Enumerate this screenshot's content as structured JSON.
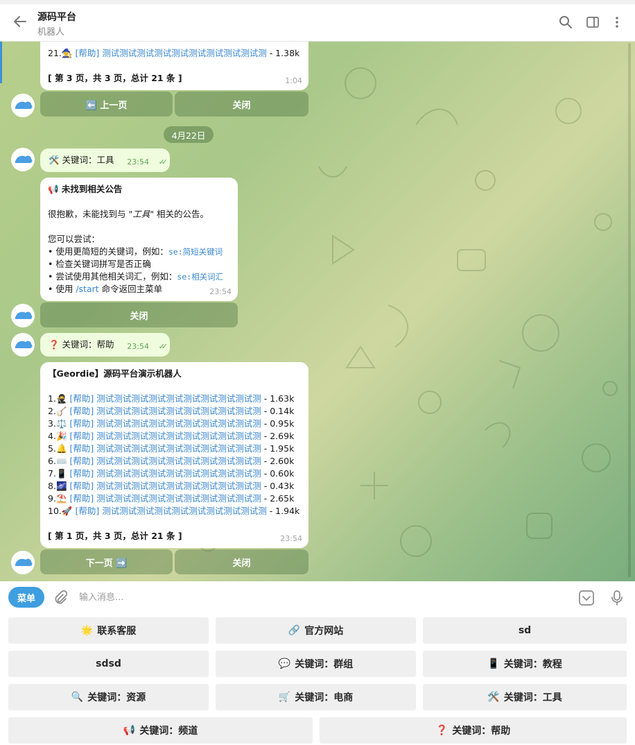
{
  "header": {
    "title": "源码平台",
    "subtitle": "机器人"
  },
  "avatar_text": "源码平台",
  "date_separator": "4月22日",
  "msg_top": {
    "line21_num": "21.",
    "line21_emoji": "🧙",
    "line21_tag": "[帮助]",
    "line21_text": "测试测试测试测试测试测试测试测试测试测",
    "line21_size": "- 1.38k",
    "page_info": "[ 第 3 页，共 3 页，总计 21 条 ]",
    "time": "1:04"
  },
  "kb_top": {
    "prev": "⬅️ 上一页",
    "close": "关闭"
  },
  "msg_kw_tool": {
    "text": "🛠️ 关键词：工具",
    "time": "23:54",
    "ticks": "✓✓"
  },
  "msg_not_found": {
    "title": "📢 未找到相关公告",
    "sorry_pre": "很抱歉，未能找到与 \"",
    "sorry_kw": "工具",
    "sorry_post": "\" 相关的公告。",
    "try": "您可以尝试：",
    "tip1_pre": "• 使用更简短的关键词，例如：",
    "tip1_code": "se:简短关键词",
    "tip2": "• 检查关键词拼写是否正确",
    "tip3_pre": "• 尝试使用其他相关词汇，例如：",
    "tip3_code": "se:相关词汇",
    "tip4_pre": "• 使用 ",
    "tip4_link": "/start",
    "tip4_post": " 命令返回主菜单",
    "time": "23:54"
  },
  "kb_mid": {
    "close": "关闭"
  },
  "msg_kw_help": {
    "text": "❓ 关键词：帮助",
    "time": "23:54",
    "ticks": "✓✓"
  },
  "msg_list": {
    "title": "【Geordie】源码平台演示机器人",
    "items": [
      {
        "num": "1.",
        "emoji": "🥷",
        "tag": "[帮助]",
        "text": "测试测试测试测试测试测试测试测试测试测",
        "size": "- 1.63k"
      },
      {
        "num": "2.",
        "emoji": "🪕",
        "tag": "[帮助]",
        "text": "测试测试测试测试测试测试测试测试测试测",
        "size": "- 0.14k"
      },
      {
        "num": "3.",
        "emoji": "⚖️",
        "tag": "[帮助]",
        "text": "测试测试测试测试测试测试测试测试测试测",
        "size": "- 0.95k"
      },
      {
        "num": "4.",
        "emoji": "🎉",
        "tag": "[帮助]",
        "text": "测试测试测试测试测试测试测试测试测试测",
        "size": "- 2.69k"
      },
      {
        "num": "5.",
        "emoji": "🔔",
        "tag": "[帮助]",
        "text": "测试测试测试测试测试测试测试测试测试测",
        "size": "- 1.95k"
      },
      {
        "num": "6.",
        "emoji": "⌨️",
        "tag": "[帮助]",
        "text": "测试测试测试测试测试测试测试测试测试测",
        "size": "- 2.60k"
      },
      {
        "num": "7.",
        "emoji": "📱",
        "tag": "[帮助]",
        "text": "测试测试测试测试测试测试测试测试测试测",
        "size": "- 0.60k"
      },
      {
        "num": "8.",
        "emoji": "🌌",
        "tag": "[帮助]",
        "text": "测试测试测试测试测试测试测试测试测试测",
        "size": "- 0.43k"
      },
      {
        "num": "9.",
        "emoji": "⛱️",
        "tag": "[帮助]",
        "text": "测试测试测试测试测试测试测试测试测试测",
        "size": "- 2.65k"
      },
      {
        "num": "10.",
        "emoji": "🚀",
        "tag": "[帮助]",
        "text": "测试测试测试测试测试测试测试测试测试测",
        "size": "- 1.94k"
      }
    ],
    "page_info": "[ 第 1 页，共 3 页，总计 21 条 ]",
    "time": "23:54"
  },
  "kb_bottom": {
    "next": "下一页 ➡️",
    "close": "关闭"
  },
  "input": {
    "menu": "菜单",
    "placeholder": "输入消息..."
  },
  "reply_keyboard": [
    {
      "emoji": "🌟",
      "label": "联系客服"
    },
    {
      "emoji": "🔗",
      "label": "官方网站"
    },
    {
      "emoji": "",
      "label": "sd"
    },
    {
      "emoji": "",
      "label": "sdsd"
    },
    {
      "emoji": "💬",
      "label": "关键词：群组"
    },
    {
      "emoji": "📱",
      "label": "关键词：教程"
    },
    {
      "emoji": "🔍",
      "label": "关键词：资源"
    },
    {
      "emoji": "🛒",
      "label": "关键词：电商"
    },
    {
      "emoji": "🛠️",
      "label": "关键词：工具"
    },
    {
      "emoji": "📢",
      "label": "关键词：频道"
    },
    {
      "emoji": "❓",
      "label": "关键词：帮助"
    }
  ],
  "colors": {
    "accent": "#3e9ee0",
    "link": "#3a87cf",
    "bubble_out": "#effdde",
    "keyboard_button": "#efefef"
  }
}
